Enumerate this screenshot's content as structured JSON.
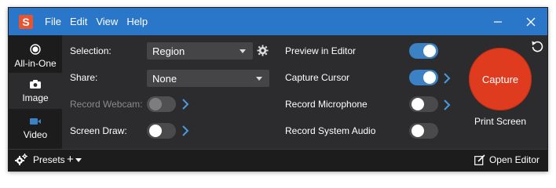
{
  "app": {
    "logo_letter": "S"
  },
  "menu": [
    "File",
    "Edit",
    "View",
    "Help"
  ],
  "modes": [
    {
      "label": "All-in-One",
      "icon": "radio-icon",
      "active": true
    },
    {
      "label": "Image",
      "icon": "camera-icon",
      "active": false
    },
    {
      "label": "Video",
      "icon": "video-camera-icon",
      "active": false
    }
  ],
  "options": {
    "selection": {
      "label": "Selection:",
      "value": "Region"
    },
    "share": {
      "label": "Share:",
      "value": "None"
    },
    "record_webcam": {
      "label": "Record Webcam:",
      "enabled": false,
      "disabled": true
    },
    "screen_draw": {
      "label": "Screen Draw:",
      "enabled": false
    },
    "preview_in_editor": {
      "label": "Preview in Editor",
      "enabled": true
    },
    "capture_cursor": {
      "label": "Capture Cursor",
      "enabled": true
    },
    "record_microphone": {
      "label": "Record Microphone",
      "enabled": false
    },
    "record_system_audio": {
      "label": "Record System Audio",
      "enabled": false
    }
  },
  "capture": {
    "button_label": "Capture",
    "shortcut_label": "Print Screen"
  },
  "footer": {
    "presets_label": "Presets",
    "add_label": "+",
    "open_editor_label": "Open Editor"
  },
  "colors": {
    "titlebar": "#2a77c9",
    "capture": "#df3b1f",
    "toggle_on": "#3b82c4",
    "chevron": "#4a9be0"
  }
}
